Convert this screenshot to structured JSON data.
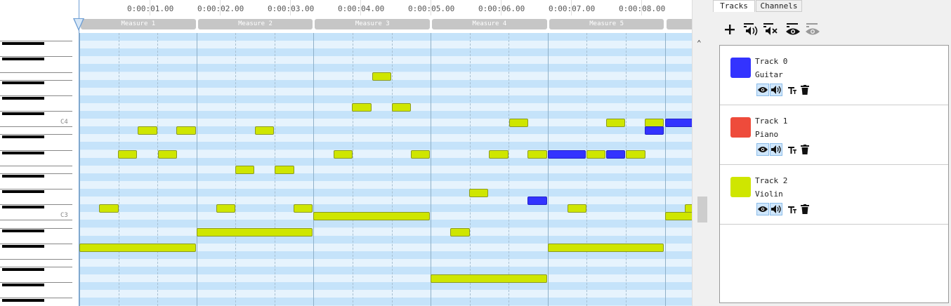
{
  "timeline": {
    "times": [
      "0:00:01.00",
      "0:00:02.00",
      "0:00:03.00",
      "0:00:04.00",
      "0:00:05.00",
      "0:00:06.00",
      "0:00:07.00",
      "0:00:08.00"
    ],
    "measures": [
      "Measure 1",
      "Measure 2",
      "Measure 3",
      "Measure 4",
      "Measure 5"
    ]
  },
  "keyboard": {
    "labels": [
      "C4",
      "C3"
    ]
  },
  "panel": {
    "tabs": [
      "Tracks",
      "Channels"
    ],
    "active_tab": "Tracks",
    "toolbar_icons": [
      "add-track-icon",
      "solo-all-icon",
      "mute-all-icon",
      "show-all-icon",
      "hide-all-icon"
    ]
  },
  "tracks": [
    {
      "name": "Track 0",
      "instrument": "Guitar",
      "color": "#3333ff"
    },
    {
      "name": "Track 1",
      "instrument": "Piano",
      "color": "#ee4b3b"
    },
    {
      "name": "Track 2",
      "instrument": "Violin",
      "color": "#cfe600"
    }
  ],
  "colors": {
    "lane_dark": "#c5e3fa",
    "lane_light": "#e6f3fd",
    "measure_line": "#8fb0c8",
    "beat_line": "#a7bfd1",
    "playhead": "#6d9ed4",
    "note_selected_border": "#8a9a22"
  },
  "notes": [
    {
      "track": 2,
      "lane": 27,
      "start": 0.0,
      "len": 1.0
    },
    {
      "track": 2,
      "lane": 22,
      "start": 0.17,
      "len": 0.17
    },
    {
      "track": 2,
      "lane": 15,
      "start": 0.33,
      "len": 0.17
    },
    {
      "track": 2,
      "lane": 12,
      "start": 0.5,
      "len": 0.17
    },
    {
      "track": 2,
      "lane": 15,
      "start": 0.67,
      "len": 0.17
    },
    {
      "track": 2,
      "lane": 12,
      "start": 0.83,
      "len": 0.17
    },
    {
      "track": 2,
      "lane": 25,
      "start": 1.0,
      "len": 1.0
    },
    {
      "track": 2,
      "lane": 22,
      "start": 1.17,
      "len": 0.17
    },
    {
      "track": 2,
      "lane": 17,
      "start": 1.33,
      "len": 0.17
    },
    {
      "track": 2,
      "lane": 12,
      "start": 1.5,
      "len": 0.17
    },
    {
      "track": 2,
      "lane": 17,
      "start": 1.67,
      "len": 0.17
    },
    {
      "track": 2,
      "lane": 22,
      "start": 1.83,
      "len": 0.17
    },
    {
      "track": 2,
      "lane": 23,
      "start": 2.0,
      "len": 1.0
    },
    {
      "track": 2,
      "lane": 15,
      "start": 2.17,
      "len": 0.17
    },
    {
      "track": 2,
      "lane": 9,
      "start": 2.33,
      "len": 0.17
    },
    {
      "track": 2,
      "lane": 5,
      "start": 2.5,
      "len": 0.17
    },
    {
      "track": 2,
      "lane": 9,
      "start": 2.67,
      "len": 0.17
    },
    {
      "track": 2,
      "lane": 15,
      "start": 2.83,
      "len": 0.17
    },
    {
      "track": 2,
      "lane": 31,
      "start": 3.0,
      "len": 1.0
    },
    {
      "track": 2,
      "lane": 25,
      "start": 3.17,
      "len": 0.17
    },
    {
      "track": 2,
      "lane": 20,
      "start": 3.33,
      "len": 0.17
    },
    {
      "track": 2,
      "lane": 15,
      "start": 3.5,
      "len": 0.17
    },
    {
      "track": 2,
      "lane": 11,
      "start": 3.67,
      "len": 0.17
    },
    {
      "track": 2,
      "lane": 15,
      "start": 3.83,
      "len": 0.17
    },
    {
      "track": 0,
      "lane": 21,
      "start": 3.83,
      "len": 0.17
    },
    {
      "track": 2,
      "lane": 27,
      "start": 4.0,
      "len": 1.0
    },
    {
      "track": 0,
      "lane": 15,
      "start": 4.0,
      "len": 0.33
    },
    {
      "track": 2,
      "lane": 15,
      "start": 4.33,
      "len": 0.17
    },
    {
      "track": 0,
      "lane": 15,
      "start": 4.5,
      "len": 0.17
    },
    {
      "track": 2,
      "lane": 22,
      "start": 4.17,
      "len": 0.17
    },
    {
      "track": 2,
      "lane": 11,
      "start": 4.5,
      "len": 0.17
    },
    {
      "track": 2,
      "lane": 15,
      "start": 4.67,
      "len": 0.17
    },
    {
      "track": 2,
      "lane": 11,
      "start": 4.83,
      "len": 0.17
    },
    {
      "track": 0,
      "lane": 12,
      "start": 4.83,
      "len": 0.17
    },
    {
      "track": 0,
      "lane": 11,
      "start": 5.0,
      "len": 0.25
    },
    {
      "track": 2,
      "lane": 23,
      "start": 5.0,
      "len": 0.33
    },
    {
      "track": 2,
      "lane": 22,
      "start": 5.17,
      "len": 0.17
    }
  ]
}
